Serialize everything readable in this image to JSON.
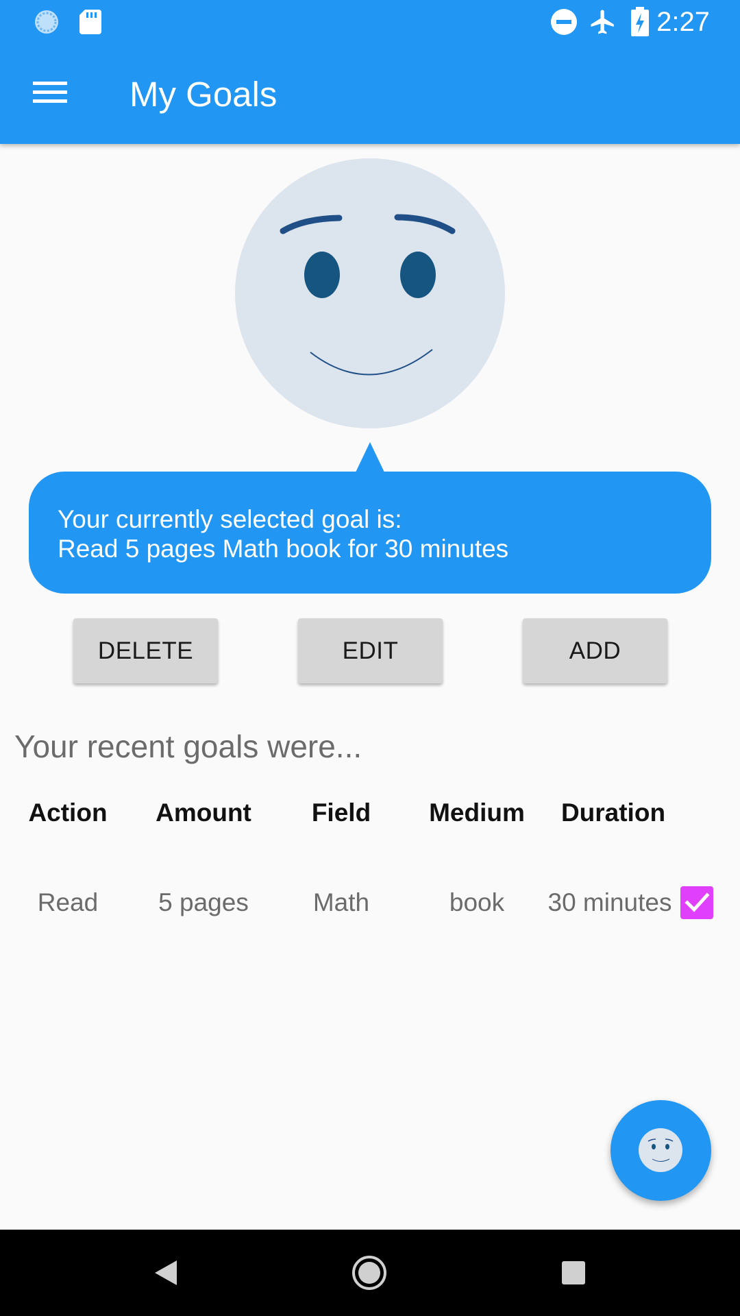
{
  "status_bar": {
    "time": "2:27",
    "icons": [
      "sync-icon",
      "sd-card-icon",
      "do-not-disturb-icon",
      "airplane-mode-icon",
      "battery-charging-icon"
    ]
  },
  "app_bar": {
    "title": "My Goals",
    "menu_icon": "hamburger-menu-icon",
    "color": "#2196f3"
  },
  "bubble": {
    "line1": "Your currently selected goal is:",
    "line2": "Read 5 pages Math book for 30 minutes"
  },
  "buttons": {
    "delete": "DELETE",
    "edit": "EDIT",
    "add": "ADD"
  },
  "recent_heading": "Your recent goals were...",
  "table": {
    "headers": [
      "Action",
      "Amount",
      "Field",
      "Medium",
      "Duration"
    ],
    "rows": [
      {
        "action": "Read",
        "amount": "5 pages",
        "field": "Math",
        "medium": "book",
        "duration": "30 minutes",
        "checked": true
      }
    ]
  },
  "colors": {
    "primary": "#2196f3",
    "checkbox": "#e040fb",
    "face_fill": "#dce4ee",
    "face_features": "#1a5580"
  },
  "fab_icon": "smiley-face-icon",
  "nav": [
    "back-icon",
    "home-icon",
    "recents-icon"
  ]
}
